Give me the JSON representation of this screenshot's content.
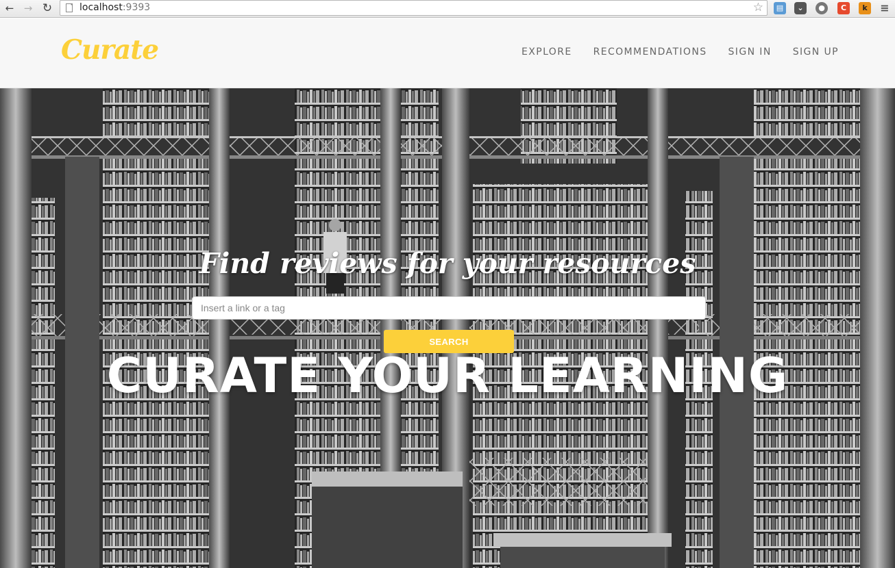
{
  "browser": {
    "url_host": "localhost",
    "url_port": ":9393",
    "back_icon": "arrow-left-icon",
    "forward_icon": "arrow-right-icon",
    "reload_icon": "reload-icon",
    "extensions": [
      "folder-icon",
      "pocket-icon",
      "steam-icon",
      "codepen-icon",
      "k-icon",
      "menu-icon"
    ]
  },
  "header": {
    "logo": "Curate",
    "nav": [
      "EXPLORE",
      "RECOMMENDATIONS",
      "SIGN IN",
      "SIGN UP"
    ]
  },
  "hero": {
    "tagline": "Find reviews for your resources",
    "search_placeholder": "Insert a link or a tag",
    "search_button": "SEARCH",
    "heading": "CURATE YOUR LEARNING"
  },
  "colors": {
    "accent": "#fcd03a",
    "nav_text": "#666666",
    "header_bg": "#f7f7f7"
  }
}
